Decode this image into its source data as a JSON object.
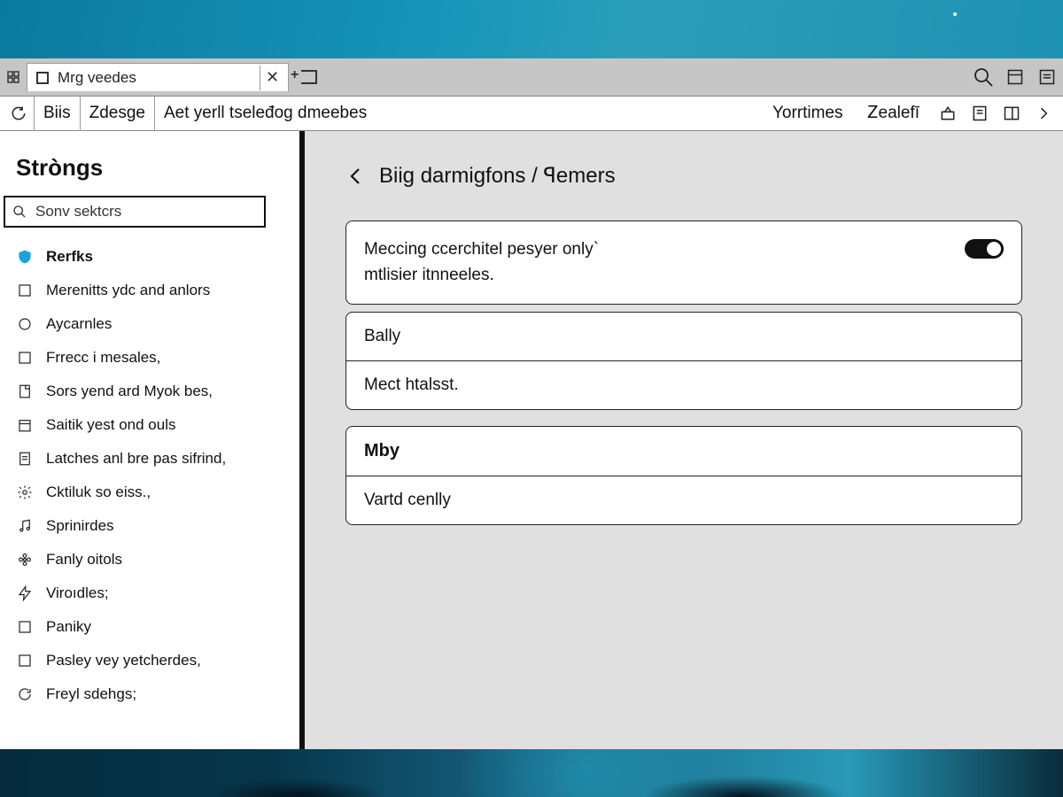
{
  "tab": {
    "title": "Mrg veedes"
  },
  "breadcrumbs": [
    "Biis",
    "Zdesge",
    "Aet yerll tseleđog dmeebes"
  ],
  "toolbar_labels": {
    "a": "Yorrtimes",
    "b": "Ꮓealefī"
  },
  "sidebar": {
    "heading": "Stròngs",
    "search_placeholder": "Sonv sektcrs",
    "items": [
      {
        "label": "Rerfks",
        "icon": "shield",
        "selected": true
      },
      {
        "label": "Merenitts ydc and anlors",
        "icon": "square"
      },
      {
        "label": "Aycarnles",
        "icon": "circle"
      },
      {
        "label": "Frrecc i mesales,",
        "icon": "square"
      },
      {
        "label": "Sors yend ard Myok bes,",
        "icon": "doc"
      },
      {
        "label": "Saitik yest ond ouls",
        "icon": "calendar"
      },
      {
        "label": "Latches anl bre pas sifrind,",
        "icon": "doc2"
      },
      {
        "label": "Cktiluk so eiss.,",
        "icon": "gear"
      },
      {
        "label": "Sprinirdes",
        "icon": "note"
      },
      {
        "label": "Fanly oitols",
        "icon": "flower"
      },
      {
        "label": "Viroıdles;",
        "icon": "bolt"
      },
      {
        "label": "Paniky",
        "icon": "square"
      },
      {
        "label": "Pasley vey yetcherdes,",
        "icon": "square"
      },
      {
        "label": "Freyl sdehgs;",
        "icon": "refresh"
      }
    ]
  },
  "content": {
    "heading": "Biig darmigfons / ꟼemers",
    "toggle_card": {
      "line1": "Meccing ccerchitel pesyer only`",
      "line2": "mtlisier itnneeles.",
      "on": true
    },
    "group1": {
      "rows": [
        "Bally",
        "Mect htalsst."
      ]
    },
    "group2": {
      "head": "Mby",
      "rows": [
        "Vartd cenlly"
      ]
    }
  }
}
